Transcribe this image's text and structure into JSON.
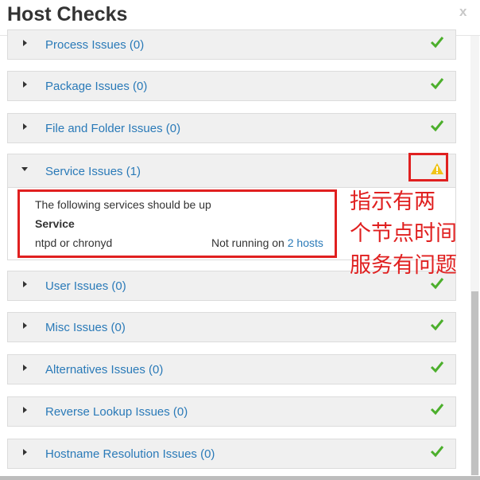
{
  "dialog": {
    "title": "Host Checks",
    "close_label": "x"
  },
  "panels": [
    {
      "label": "Process Issues (0)",
      "status": "ok"
    },
    {
      "label": "Package Issues (0)",
      "status": "ok"
    },
    {
      "label": "File and Folder Issues (0)",
      "status": "ok"
    },
    {
      "label": "Service Issues (1)",
      "status": "warning",
      "expanded": true
    },
    {
      "label": "User Issues (0)",
      "status": "ok"
    },
    {
      "label": "Misc Issues (0)",
      "status": "ok"
    },
    {
      "label": "Alternatives Issues (0)",
      "status": "ok"
    },
    {
      "label": "Reverse Lookup Issues (0)",
      "status": "ok"
    },
    {
      "label": "Hostname Resolution Issues (0)",
      "status": "ok"
    }
  ],
  "service_detail": {
    "intro": "The following services should be up",
    "column_header": "Service",
    "service_name": "ntpd or chronyd",
    "status_prefix": "Not running on ",
    "hosts_link": "2 hosts"
  },
  "annotation": {
    "lines": [
      "指示有两",
      "个节点时间",
      "服务有问题"
    ]
  },
  "colors": {
    "link": "#2a7ab8",
    "ok": "#4caf2c",
    "warning": "#f0c419",
    "annotation": "#e02020"
  },
  "icons": {
    "ok": "check-icon",
    "warning": "warning-triangle-icon",
    "collapsed": "caret-right-icon",
    "expanded": "caret-down-icon"
  }
}
